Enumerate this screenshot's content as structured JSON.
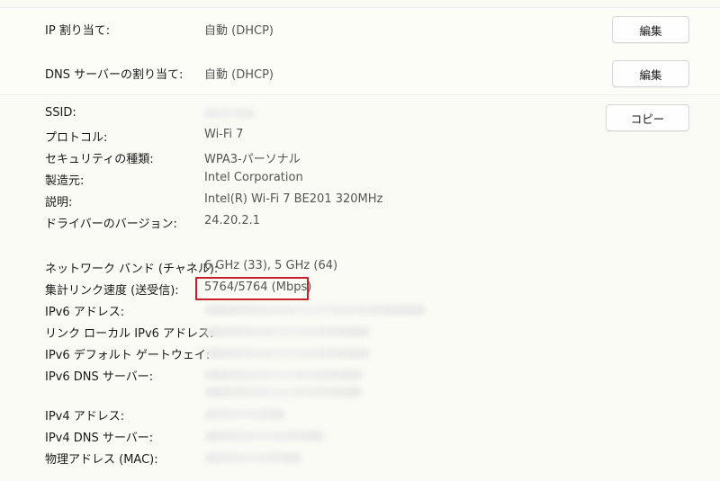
{
  "ip_assignment": {
    "label": "IP 割り当て:",
    "value": "自動 (DHCP)",
    "button": "編集"
  },
  "dns_assignment": {
    "label": "DNS サーバーの割り当て:",
    "value": "自動 (DHCP)",
    "button": "編集"
  },
  "properties": {
    "copy_button": "コピー",
    "ssid_label": "SSID:",
    "protocol": {
      "label": "プロトコル:",
      "value": "Wi-Fi 7"
    },
    "security": {
      "label": "セキュリティの種類:",
      "value": "WPA3-パーソナル"
    },
    "manufacturer": {
      "label": "製造元:",
      "value": "Intel Corporation"
    },
    "description": {
      "label": "説明:",
      "value": "Intel(R) Wi-Fi 7 BE201 320MHz"
    },
    "driver_version": {
      "label": "ドライバーのバージョン:",
      "value": "24.20.2.1"
    },
    "network_band": {
      "label": "ネットワーク バンド (チャネル):",
      "value": "6 GHz (33), 5 GHz (64)"
    },
    "link_speed": {
      "label": "集計リンク速度 (送受信):",
      "value": "5764/5764 (Mbps)"
    },
    "ipv6_address_label": "IPv6 アドレス:",
    "link_local_ipv6_label": "リンク ローカル IPv6 アドレス:",
    "ipv6_gateway_label": "IPv6 デフォルト ゲートウェイ:",
    "ipv6_dns_label": "IPv6 DNS サーバー:",
    "ipv4_address_label": "IPv4 アドレス:",
    "ipv4_dns_label": "IPv4 DNS サーバー:",
    "mac_label": "物理アドレス (MAC):"
  },
  "colors": {
    "highlight": "#c8202a"
  }
}
